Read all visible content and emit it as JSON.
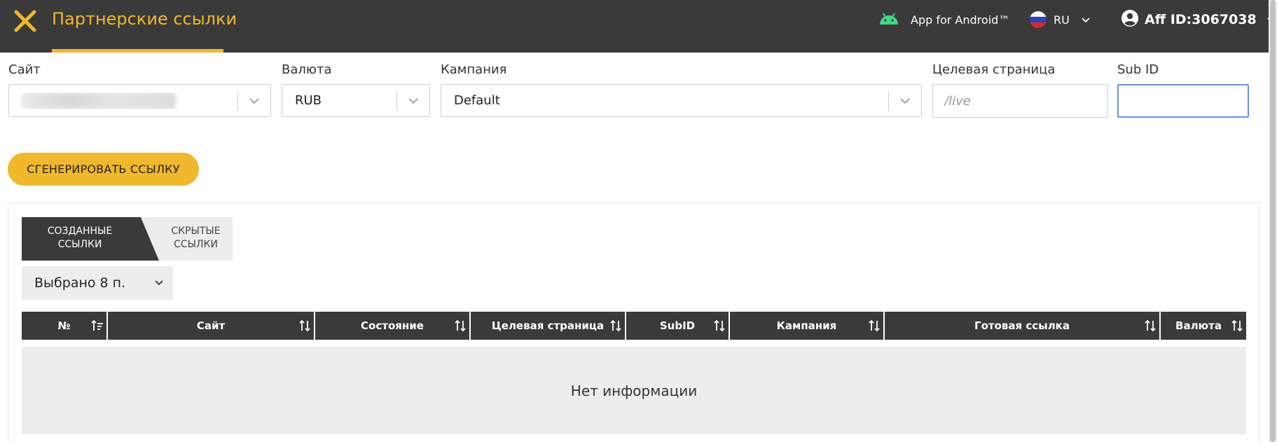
{
  "header": {
    "title": "Партнерские ссылки",
    "android_label": "App for Android™",
    "language": "RU",
    "account": "Aff ID:3067038",
    "accent_color": "#f0b92b",
    "bar_color": "#3a3a3a"
  },
  "form": {
    "site": {
      "label": "Сайт",
      "value": ""
    },
    "currency": {
      "label": "Валюта",
      "value": "RUB"
    },
    "campaign": {
      "label": "Кампания",
      "value": "Default"
    },
    "landing": {
      "label": "Целевая страница",
      "placeholder": "/live",
      "value": ""
    },
    "subid": {
      "label": "Sub ID",
      "value": ""
    }
  },
  "generate_button": "СГЕНЕРИРОВАТЬ ССЫЛКУ",
  "tabs": [
    {
      "line1": "СОЗДАННЫЕ",
      "line2": "ССЫЛКИ",
      "active": true
    },
    {
      "line1": "СКРЫТЫЕ",
      "line2": "ССЫЛКИ",
      "active": false
    }
  ],
  "columns_dropdown": "Выбрано 8 п.",
  "table": {
    "columns": [
      "№",
      "Сайт",
      "Состояние",
      "Целевая страница",
      "SubID",
      "Кампания",
      "Готовая ссылка",
      "Валюта"
    ],
    "empty_text": "Нет информации"
  },
  "icons": {
    "close": "close-icon",
    "android": "android-icon",
    "flag": "russia-flag-icon",
    "account": "account-circle-icon",
    "chevron": "chevron-down-icon",
    "sort": "sort-icon"
  }
}
